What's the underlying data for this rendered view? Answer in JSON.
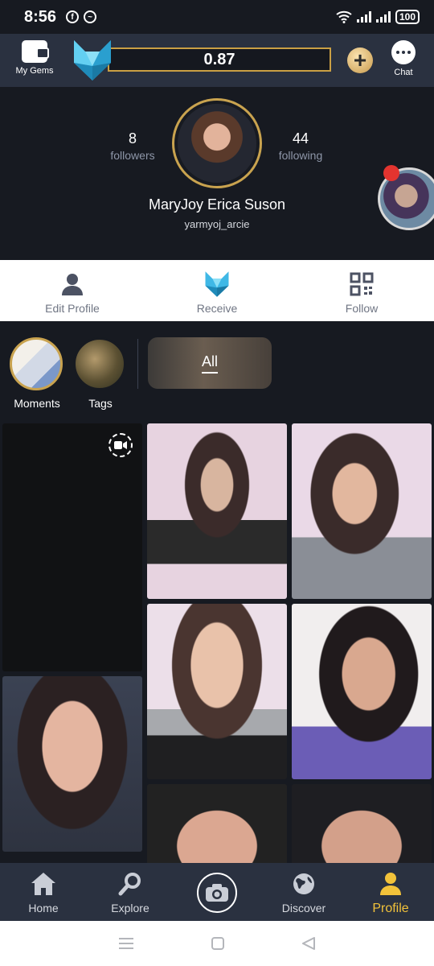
{
  "status": {
    "time": "8:56",
    "battery": "100"
  },
  "topbar": {
    "gems_label": "My Gems",
    "balance": "0.87",
    "chat_label": "Chat"
  },
  "profile": {
    "followers_count": "8",
    "followers_label": "followers",
    "following_count": "44",
    "following_label": "following",
    "name": "MaryJoy Erica Suson",
    "handle": "yarmyoj_arcie"
  },
  "actions": [
    {
      "label": "Edit Profile",
      "icon": "person-icon"
    },
    {
      "label": "Receive",
      "icon": "fox-logo-icon"
    },
    {
      "label": "Follow",
      "icon": "qr-code-icon"
    }
  ],
  "stories": {
    "moments_label": "Moments",
    "tags_label": "Tags",
    "all_label": "All"
  },
  "bottom_nav": [
    {
      "label": "Home",
      "icon": "home-icon"
    },
    {
      "label": "Explore",
      "icon": "search-icon"
    },
    {
      "label": "",
      "icon": "camera-icon"
    },
    {
      "label": "Discover",
      "icon": "globe-icon"
    },
    {
      "label": "Profile",
      "icon": "person-icon",
      "active": true
    }
  ],
  "colors": {
    "accent_gold": "#c9a34f",
    "active_yellow": "#f2c23a",
    "bg_dark": "#171a21",
    "bar_bg": "#2a3140"
  }
}
